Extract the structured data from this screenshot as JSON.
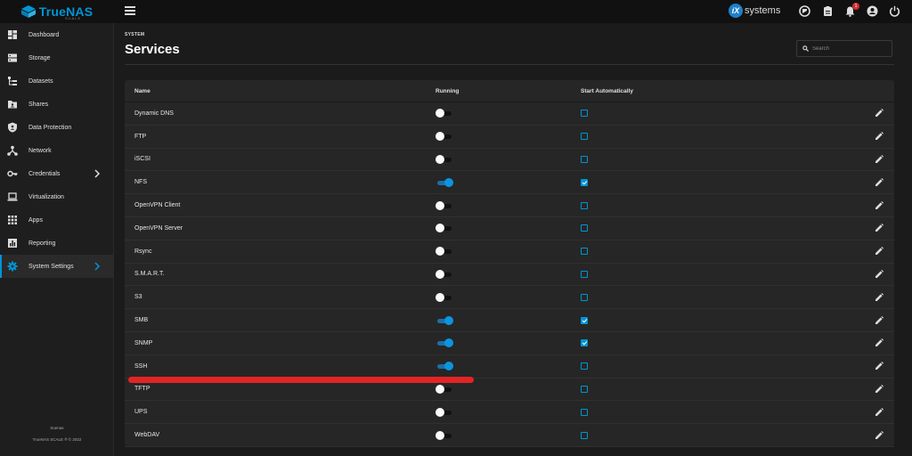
{
  "app": {
    "logo_text": "TrueNAS",
    "logo_sub": "SCALE",
    "vendor": "systems",
    "vendor_badge": "iX",
    "alert_count": "1"
  },
  "sidebar": {
    "items": [
      {
        "label": "Dashboard",
        "icon": "dashboard-icon"
      },
      {
        "label": "Storage",
        "icon": "storage-icon"
      },
      {
        "label": "Datasets",
        "icon": "datasets-icon"
      },
      {
        "label": "Shares",
        "icon": "shares-icon"
      },
      {
        "label": "Data Protection",
        "icon": "shield-icon"
      },
      {
        "label": "Network",
        "icon": "network-icon"
      },
      {
        "label": "Credentials",
        "icon": "key-icon"
      },
      {
        "label": "Virtualization",
        "icon": "laptop-icon"
      },
      {
        "label": "Apps",
        "icon": "apps-grid-icon"
      },
      {
        "label": "Reporting",
        "icon": "chart-icon"
      },
      {
        "label": "System Settings",
        "icon": "gear-icon"
      }
    ],
    "footer_host": "truenas",
    "footer_copyright": "TrueNAS SCALE ® © 2022"
  },
  "page": {
    "section": "SYSTEM",
    "title": "Services",
    "search_placeholder": "Search"
  },
  "table": {
    "headers": {
      "name": "Name",
      "running": "Running",
      "auto": "Start Automatically"
    },
    "rows": [
      {
        "name": "Dynamic DNS",
        "running": false,
        "auto": false
      },
      {
        "name": "FTP",
        "running": false,
        "auto": false
      },
      {
        "name": "iSCSI",
        "running": false,
        "auto": false
      },
      {
        "name": "NFS",
        "running": true,
        "auto": true
      },
      {
        "name": "OpenVPN Client",
        "running": false,
        "auto": false
      },
      {
        "name": "OpenVPN Server",
        "running": false,
        "auto": false
      },
      {
        "name": "Rsync",
        "running": false,
        "auto": false
      },
      {
        "name": "S.M.A.R.T.",
        "running": false,
        "auto": false
      },
      {
        "name": "S3",
        "running": false,
        "auto": false
      },
      {
        "name": "SMB",
        "running": true,
        "auto": true
      },
      {
        "name": "SNMP",
        "running": true,
        "auto": true
      },
      {
        "name": "SSH",
        "running": true,
        "auto": false
      },
      {
        "name": "TFTP",
        "running": false,
        "auto": false
      },
      {
        "name": "UPS",
        "running": false,
        "auto": false
      },
      {
        "name": "WebDAV",
        "running": false,
        "auto": false
      }
    ]
  },
  "colors": {
    "accent": "#0095d5",
    "annotation_line": "#e32424"
  }
}
